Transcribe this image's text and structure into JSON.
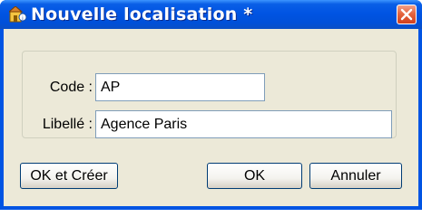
{
  "window": {
    "title": "Nouvelle localisation *",
    "icon": "location-icon"
  },
  "form": {
    "code_label": "Code :",
    "code_value": "AP",
    "libelle_label": "Libellé :",
    "libelle_value": "Agence Paris"
  },
  "buttons": {
    "ok_create": "OK et Créer",
    "ok": "OK",
    "cancel": "Annuler"
  },
  "colors": {
    "titlebar": "#0054e3",
    "client_bg": "#ece9d8",
    "close_button": "#d1401d"
  }
}
